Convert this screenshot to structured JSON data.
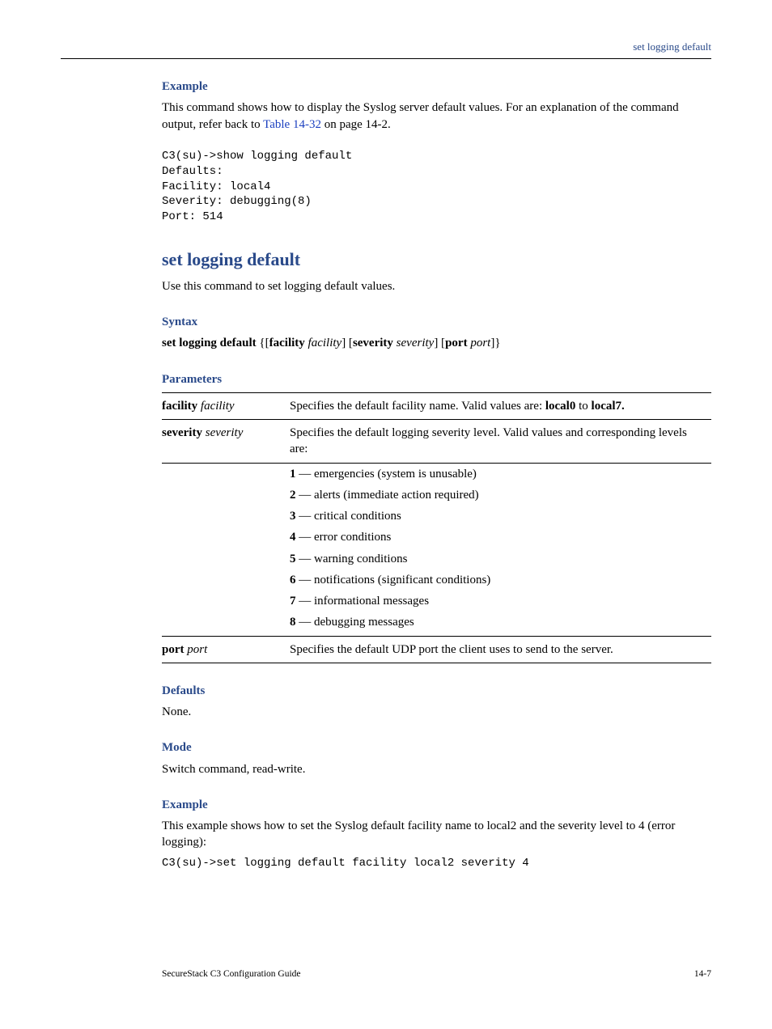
{
  "header": {
    "right": "set logging default"
  },
  "intro": {
    "h3": "Example",
    "para_pre": "This command shows how to display the Syslog server default values. For an explanation of the command output, refer back to ",
    "link": "Table 14-32",
    "para_post": " on page 14-2.",
    "code": "C3(su)->show logging default\nDefaults:\nFacility: local4\nSeverity: debugging(8)\nPort: 514"
  },
  "command": {
    "title": "set logging default",
    "desc": "Use this command to set logging default values."
  },
  "syntax": {
    "heading": "Syntax",
    "kw": "set logging default",
    "rest": " {[facility ",
    "p1i": "facility",
    "mid1": "] [severity ",
    "p2i": "severity",
    "mid2": "] [port ",
    "p3i": "port",
    "end": "]}"
  },
  "params": {
    "heading": "Parameters",
    "rows": [
      {
        "name_b": "facility",
        "name_i": "facility",
        "desc_pre": "Specifies the default facility name. Valid values are: ",
        "desc_b1": "local0",
        "desc_mid": " to ",
        "desc_b2": "local7."
      },
      {
        "name_b": "severity",
        "name_i": "severity",
        "desc": "Specifies the default logging severity level. Valid values and corresponding levels are:"
      }
    ],
    "sev": [
      {
        "n": "1",
        "t": " — emergencies (system is unusable)"
      },
      {
        "n": "2",
        "t": " — alerts (immediate action required)"
      },
      {
        "n": "3",
        "t": " — critical conditions"
      },
      {
        "n": "4",
        "t": " — error conditions"
      },
      {
        "n": "5",
        "t": " — warning conditions"
      },
      {
        "n": "6",
        "t": " — notifications (significant conditions)"
      },
      {
        "n": "7",
        "t": " — informational messages"
      },
      {
        "n": "8",
        "t": " — debugging messages"
      }
    ],
    "port": {
      "name_b": "port",
      "name_i": "port",
      "desc": "Specifies the default UDP port the client uses to send to the server."
    }
  },
  "defaults": {
    "heading": "Defaults",
    "text": "None."
  },
  "mode": {
    "heading": "Mode",
    "text": "Switch command, read-write."
  },
  "example": {
    "heading": "Example",
    "text": "This example shows how to set the Syslog default facility name to local2 and the severity level to 4 (error logging):",
    "code": "C3(su)->set logging default facility local2 severity 4"
  },
  "footer": {
    "left": "SecureStack C3 Configuration Guide",
    "right": "14-7"
  }
}
